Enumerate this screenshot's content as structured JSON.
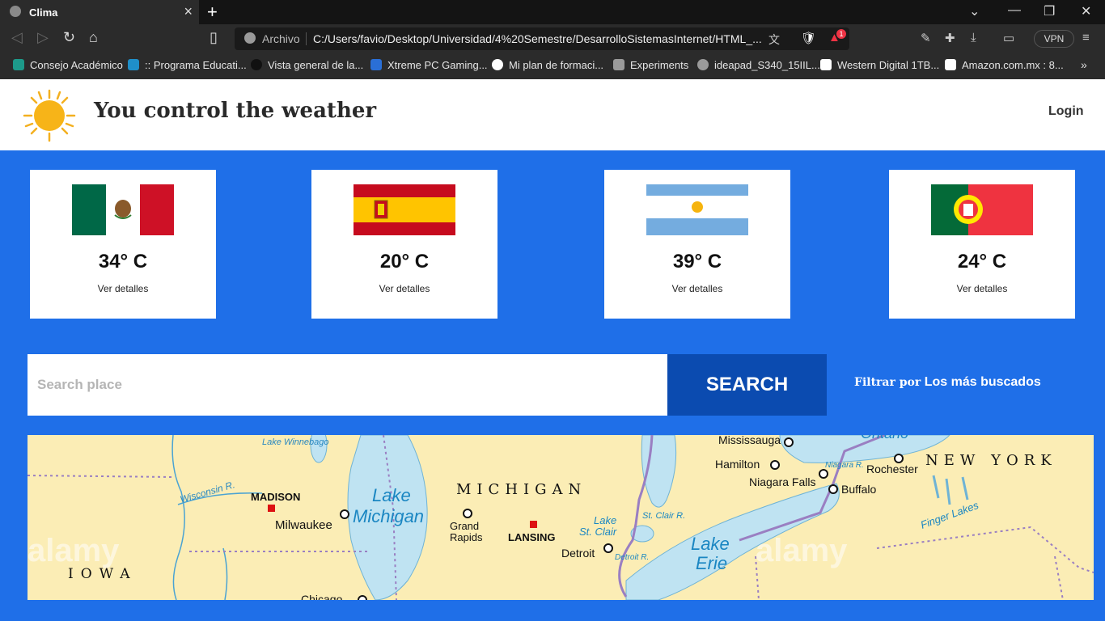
{
  "browser": {
    "tab_title": "Clima",
    "address_prefix": "Archivo",
    "url": "C:/Users/favio/Desktop/Universidad/4%20Semestre/DesarrolloSistemasInternet/HTML_...",
    "vpn_label": "VPN",
    "alert_count": "1",
    "bookmarks": [
      {
        "label": "Consejo Académico",
        "color": "#1d9a8a"
      },
      {
        "label": ":: Programa Educati...",
        "color": "#1f8fc9"
      },
      {
        "label": "Vista general de la...",
        "color": "#222222"
      },
      {
        "label": "Xtreme PC Gaming...",
        "color": "#2a6fd6"
      },
      {
        "label": "Mi plan de formaci...",
        "color": "#ffffff"
      },
      {
        "label": "Experiments",
        "color": "#9a9a9a"
      },
      {
        "label": "ideapad_S340_15IIL...",
        "color": "#9a9a9a"
      },
      {
        "label": "Western Digital 1TB...",
        "color": "#ffffff"
      },
      {
        "label": "Amazon.com.mx : 8...",
        "color": "#ffffff"
      }
    ]
  },
  "header": {
    "brand": "You control the weather",
    "login_label": "Login"
  },
  "cards": [
    {
      "country_flag": "mexico-flag-icon",
      "temp": "34° C",
      "details_label": "Ver detalles"
    },
    {
      "country_flag": "spain-flag-icon",
      "temp": "20° C",
      "details_label": "Ver detalles"
    },
    {
      "country_flag": "argentina-flag-icon",
      "temp": "39° C",
      "details_label": "Ver detalles"
    },
    {
      "country_flag": "portugal-flag-icon",
      "temp": "24° C",
      "details_label": "Ver detalles"
    }
  ],
  "search": {
    "placeholder": "Search place",
    "button_label": "SEARCH",
    "filter_prefix": "Filtrar por",
    "filter_value": "Los más buscados"
  },
  "map": {
    "labels": {
      "winnebago": "Lake Winnebago",
      "wisconsin_r": "Wisconsin R.",
      "madison": "MADISON",
      "milwaukee": "Milwaukee",
      "lake_michigan_1": "Lake",
      "lake_michigan_2": "Michigan",
      "michigan": "MICHIGAN",
      "grand_rapids_1": "Grand",
      "grand_rapids_2": "Rapids",
      "lansing": "LANSING",
      "iowa": "IOWA",
      "chicago": "Chicago",
      "lake_st_clair_1": "Lake",
      "lake_st_clair_2": "St. Clair",
      "st_clair_r": "St. Clair R.",
      "detroit": "Detroit",
      "detroit_r": "Detroit R.",
      "lake_erie_1": "Lake",
      "lake_erie_2": "Erie",
      "mississauga": "Mississauga",
      "hamilton": "Hamilton",
      "niagara_falls": "Niagara Falls",
      "niagara_r": "Niagara R.",
      "buffalo": "Buffalo",
      "rochester": "Rochester",
      "new_york": "NEW YORK",
      "ontario": "Ontario",
      "finger_lakes": "Finger Lakes",
      "watermark": "alamy"
    }
  }
}
